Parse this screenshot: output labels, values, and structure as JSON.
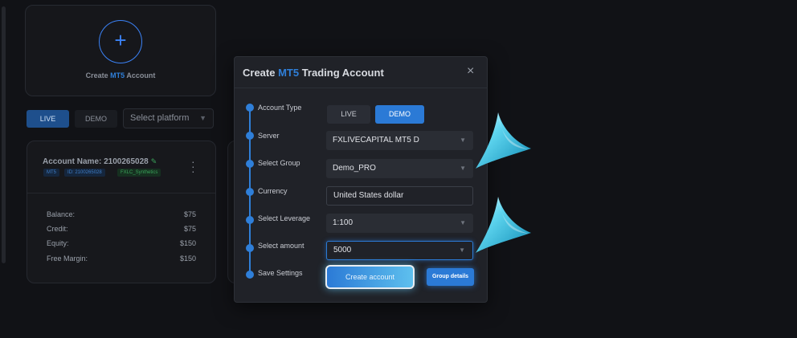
{
  "background": {
    "create_card": {
      "prefix": "Create ",
      "highlight": "MT5",
      "suffix": " Account",
      "icon": "plus-icon"
    },
    "tabs": {
      "live": "LIVE",
      "demo": "DEMO"
    },
    "platform_select": {
      "value": "Select platform",
      "icon": "chevron-down-icon"
    },
    "account_card": {
      "name_label": "Account Name: 2100265028",
      "badges": {
        "platform": "MT5",
        "id": "ID: 2100265028",
        "group": "FXLC_Synthetics"
      },
      "stats": [
        {
          "label": "Balance:",
          "value": "$75"
        },
        {
          "label": "Credit:",
          "value": "$75"
        },
        {
          "label": "Equity:",
          "value": "$150"
        },
        {
          "label": "Free Margin:",
          "value": "$150"
        }
      ]
    }
  },
  "modal": {
    "title_prefix": "Create ",
    "title_highlight": "MT5",
    "title_suffix": " Trading Account",
    "close_icon": "×",
    "steps": [
      {
        "label": "Account Type"
      },
      {
        "label": "Server"
      },
      {
        "label": "Select Group"
      },
      {
        "label": "Currency"
      },
      {
        "label": "Select Leverage"
      },
      {
        "label": "Select amount"
      },
      {
        "label": "Save Settings"
      }
    ],
    "account_type": {
      "live": "LIVE",
      "demo": "DEMO",
      "selected": "DEMO"
    },
    "server": "FXLIVECAPITAL MT5 D",
    "group": "Demo_PRO",
    "currency": "United States dollar",
    "leverage": "1:100",
    "amount": "5000",
    "create_button": "Create account",
    "details_button": "Group details"
  },
  "colors": {
    "accent": "#2b7ad6",
    "highlight": "#2f7fd9",
    "pointer": "#2ab4d9",
    "success": "#3aa35a"
  }
}
